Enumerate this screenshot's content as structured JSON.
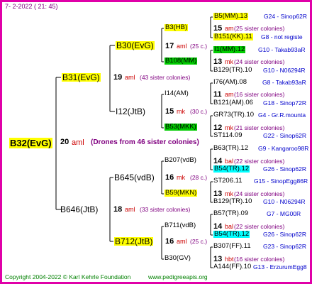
{
  "header": {
    "date": "7-  2-2022 ( 21: 45)"
  },
  "root": {
    "label": "B32(EvG)",
    "count": "20",
    "prefix": "aml",
    "drones": "(Drones from 46 sister colonies)"
  },
  "gen1": [
    {
      "label": "B31(EvG)",
      "count": "19",
      "prefix": "aml",
      "colonies": "(43 sister colonies)"
    },
    {
      "label": "B646(JtB)",
      "count": "18",
      "prefix": "aml",
      "colonies": "(33 sister colonies)"
    }
  ],
  "gen2": [
    {
      "label": "B30(EvG)",
      "count": "17",
      "prefix": "aml",
      "colonies": "(25 c.)"
    },
    {
      "label": "I12(JtB)",
      "count": "15",
      "prefix": "mk",
      "colonies": "(30 c.)"
    },
    {
      "label": "B645(vdB)",
      "count": "16",
      "prefix": "mk",
      "colonies": "(28 c.)"
    },
    {
      "label": "B712(JtB)",
      "count": "16",
      "prefix": "aml",
      "colonies": "(25 c.)"
    }
  ],
  "gen3": [
    {
      "label": "B3(HB)",
      "count": "15",
      "prefix": "am",
      "colonies": "(25 sister colonies)"
    },
    {
      "label": "B108(MM)",
      "count": "13",
      "prefix": "mk",
      "colonies": "(24 sister colonies)"
    },
    {
      "label": "I14(AM)",
      "count": "11",
      "prefix": "am",
      "colonies": "(16 sister colonies)"
    },
    {
      "label": "B53(MKK)",
      "count": "12",
      "prefix": "mk",
      "colonies": "(21 sister colonies)"
    },
    {
      "label": "B207(vdB)",
      "count": "14",
      "prefix": "bal",
      "colonies": "(22 sister colonies)"
    },
    {
      "label": "B59(MKN)",
      "count": "13",
      "prefix": "mk",
      "colonies": "(24 sister colonies)"
    },
    {
      "label": "B711(vdB)",
      "count": "14",
      "prefix": "bal",
      "colonies": "(22 sister colonies)"
    },
    {
      "label": "B30(GV)",
      "count": "13",
      "prefix": "hbt",
      "colonies": "(16 sister colonies)"
    }
  ],
  "gen4": [
    {
      "label": "B5(MM).13",
      "code": "G24 - Sinop62R"
    },
    {
      "label": "B151(KK).11",
      "code": "G8 - not registe"
    },
    {
      "label": "I1(MM).12",
      "code": "G10 - Takab93aR"
    },
    {
      "label": "B129(TR).10",
      "code": "G10 - N06294R"
    },
    {
      "label": "I76(AM).08",
      "code": "G8 - Takab93aR"
    },
    {
      "label": "B121(AM).06",
      "code": "G18 - Sinop72R"
    },
    {
      "label": "GR73(TR).10",
      "code": "G4 - Gr.R.mounta"
    },
    {
      "label": "ST114.09",
      "code": "G22 - Sinop62R"
    },
    {
      "label": "B63(TR).12",
      "code": "G9 - Kangaroo98R"
    },
    {
      "label": "B54(TR).12",
      "code": "G26 - Sinop62R"
    },
    {
      "label": "ST206.11",
      "code": "G15 - SinopEgg86R"
    },
    {
      "label": "B129(TR).10",
      "code": "G10 - N06294R"
    },
    {
      "label": "B57(TR).09",
      "code": "G7 - MG00R"
    },
    {
      "label": "B54(TR).12",
      "code": "G26 - Sinop62R"
    },
    {
      "label": "B307(FF).11",
      "code": "G23 - Sinop62R"
    },
    {
      "label": "A144(FF).10",
      "code": "G13 - ErzurumEgg8"
    }
  ],
  "footer": {
    "copyright": "Copyright 2004-2022 © Karl Kehrle Foundation",
    "site": "www.pedigreeapis.org"
  }
}
